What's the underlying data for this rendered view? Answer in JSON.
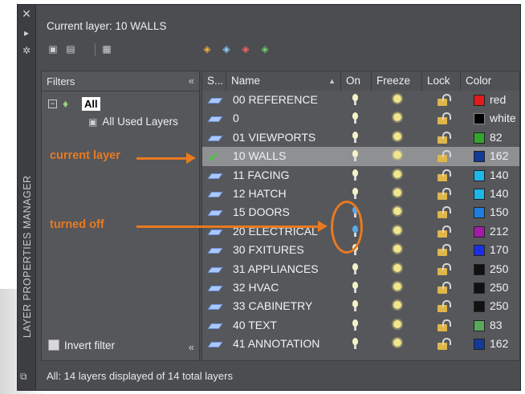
{
  "palette": {
    "title": "LAYER PROPERTIES MANAGER",
    "current_layer": "Current layer: 10 WALLS"
  },
  "filters": {
    "header": "Filters",
    "collapse_glyph": "«",
    "tree": [
      {
        "label": "All"
      },
      {
        "label": "All Used Layers"
      }
    ],
    "invert_filter": "Invert filter"
  },
  "grid": {
    "columns": [
      "S...",
      "Name",
      "On",
      "Freeze",
      "Lock",
      "Color"
    ],
    "rows": [
      {
        "name": "00 REFERENCE",
        "on": true,
        "color_name": "red",
        "color": "#e01c1c"
      },
      {
        "name": "0",
        "on": true,
        "color_name": "white",
        "color": "#000000"
      },
      {
        "name": "01 VIEWPORTS",
        "on": true,
        "color_name": "82",
        "color": "#33a52d"
      },
      {
        "name": "10 WALLS",
        "on": true,
        "color_name": "162",
        "color": "#123a96",
        "current": true
      },
      {
        "name": "11 FACING",
        "on": true,
        "color_name": "140",
        "color": "#1fb6e8"
      },
      {
        "name": "12 HATCH",
        "on": true,
        "color_name": "140",
        "color": "#1fb6e8"
      },
      {
        "name": "15 DOORS",
        "on": false,
        "color_name": "150",
        "color": "#1c7ee0"
      },
      {
        "name": "20 ELECTRICAL",
        "on": false,
        "color_name": "212",
        "color": "#a31aa8"
      },
      {
        "name": "30 FXITURES",
        "on": true,
        "color_name": "170",
        "color": "#1a2ee6"
      },
      {
        "name": "31 APPLIANCES",
        "on": true,
        "color_name": "250",
        "color": "#111111"
      },
      {
        "name": "32 HVAC",
        "on": true,
        "color_name": "250",
        "color": "#111111"
      },
      {
        "name": "33 CABINETRY",
        "on": true,
        "color_name": "250",
        "color": "#111111"
      },
      {
        "name": "40 TEXT",
        "on": true,
        "color_name": "83",
        "color": "#5aa85a"
      },
      {
        "name": "41 ANNOTATION",
        "on": true,
        "color_name": "162",
        "color": "#123a96"
      }
    ]
  },
  "footer": "All: 14 layers displayed of 14 total layers",
  "annotations": {
    "current_layer": "current layer",
    "turned_off": "turned off",
    "accent": "#e87a1f"
  },
  "icons": {
    "close": "close-icon",
    "autohide": "autohide-icon",
    "properties": "properties-icon",
    "layer_states": "layer-states-icon"
  }
}
